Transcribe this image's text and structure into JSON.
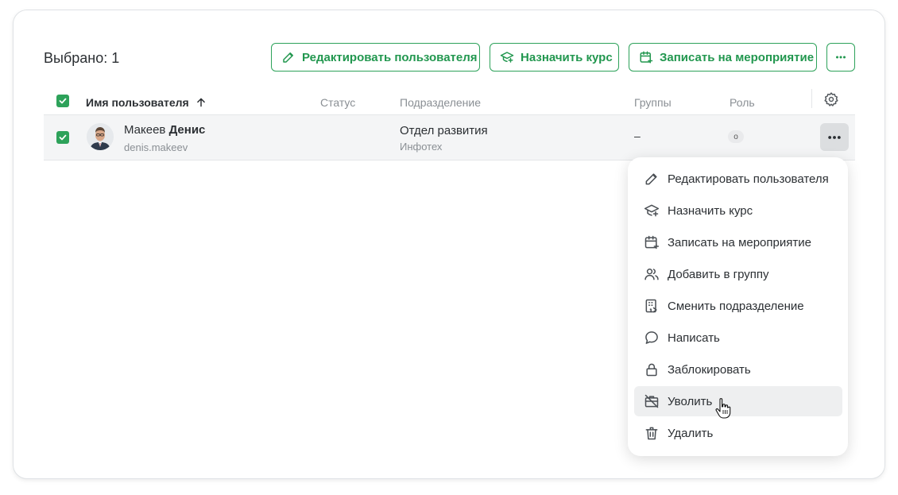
{
  "toolbar": {
    "selected_label": "Выбрано: 1",
    "edit_user_label": "Редактировать пользователя",
    "assign_course_label": "Назначить курс",
    "enroll_event_label": "Записать на мероприятие",
    "more_icon": "more-horizontal-icon"
  },
  "table": {
    "columns": {
      "name": "Имя пользователя",
      "status": "Статус",
      "department": "Подразделение",
      "groups": "Группы",
      "role": "Роль"
    },
    "sort_icon": "arrow-up-icon",
    "settings_icon": "gear-icon",
    "rows": [
      {
        "selected": true,
        "last_name": "Макеев",
        "first_name": "Денис",
        "login": "denis.makeev",
        "department": "Отдел развития",
        "organization": "Инфотех",
        "groups": "–",
        "role_badge": "о"
      }
    ]
  },
  "context_menu": {
    "items": [
      {
        "label": "Редактировать пользователя",
        "icon": "pencil-icon"
      },
      {
        "label": "Назначить курс",
        "icon": "graduation-cap-icon"
      },
      {
        "label": "Записать на мероприятие",
        "icon": "calendar-plus-icon"
      },
      {
        "label": "Добавить в группу",
        "icon": "users-icon"
      },
      {
        "label": "Сменить подразделение",
        "icon": "building-icon"
      },
      {
        "label": "Написать",
        "icon": "message-icon"
      },
      {
        "label": "Заблокировать",
        "icon": "lock-icon"
      },
      {
        "label": "Уволить",
        "icon": "briefcase-off-icon",
        "hovered": true
      },
      {
        "label": "Удалить",
        "icon": "trash-icon"
      }
    ]
  },
  "colors": {
    "accent": "#2da25a",
    "accent_text": "#22974f",
    "text": "#2b2f33",
    "muted": "#8a8f94",
    "row_bg": "#f4f5f6"
  }
}
